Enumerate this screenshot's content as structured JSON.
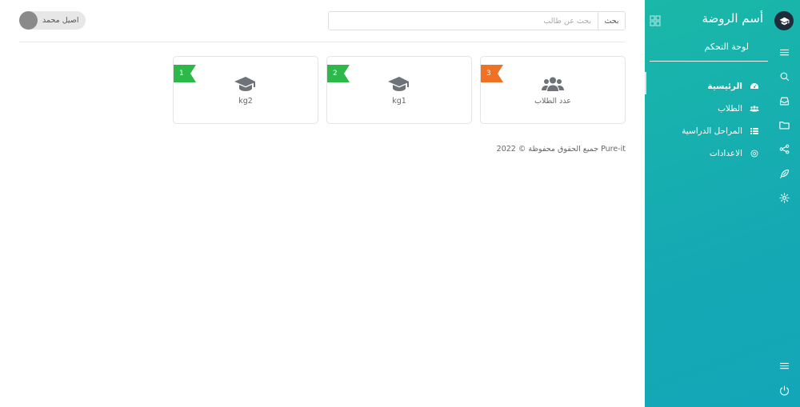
{
  "sidebar": {
    "brand": "أسم الروضة",
    "section_title": "لوحة التحكم",
    "menu": [
      {
        "label": "الرئيسية",
        "icon": "dashboard-icon",
        "active": true
      },
      {
        "label": "الطلاب",
        "icon": "users-icon",
        "active": false
      },
      {
        "label": "المراحل الدراسية",
        "icon": "list-icon",
        "active": false
      },
      {
        "label": "الاعدادات",
        "icon": "gear-icon",
        "active": false
      }
    ],
    "rail_icons": [
      "menu-icon",
      "search-icon",
      "inbox-icon",
      "folder-icon",
      "share-icon",
      "feather-icon",
      "gear-icon"
    ],
    "bottom_icons": [
      "menu-icon",
      "power-icon"
    ]
  },
  "header": {
    "search_placeholder": "بحث عن طالب",
    "search_button": "بحث",
    "user_name": "اصيل محمد"
  },
  "cards": [
    {
      "label": "عدد الطلاب",
      "badge": "3",
      "badge_color": "#f07124",
      "icon": "users-icon"
    },
    {
      "label": "kg1",
      "badge": "2",
      "badge_color": "#2db84a",
      "icon": "graduation-cap-icon"
    },
    {
      "label": "kg2",
      "badge": "1",
      "badge_color": "#2db84a",
      "icon": "graduation-cap-icon"
    }
  ],
  "footer": {
    "text": "جميع الحقوق محفوظة © 2022 Pure-it"
  },
  "colors": {
    "sidebar": "#15aab2",
    "text": "#555555"
  }
}
